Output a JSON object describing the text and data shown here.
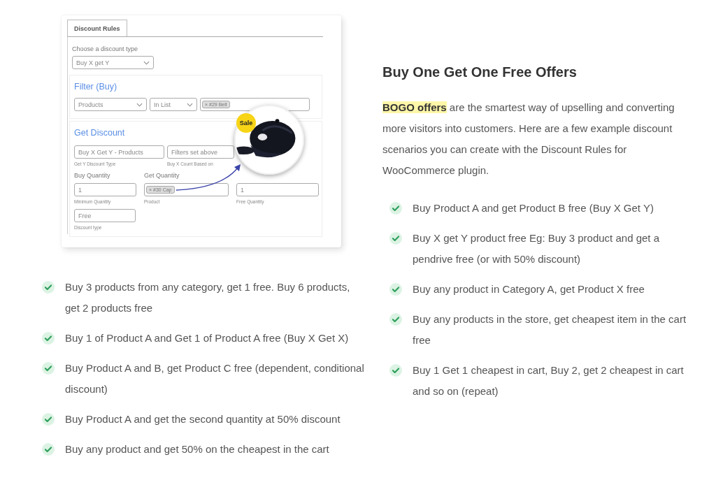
{
  "screenshot": {
    "tab": "Discount Rules",
    "type_label": "Choose a discount type",
    "type_value": "Buy X get Y",
    "filter": {
      "title": "Filter (Buy)",
      "field": "Products",
      "operator": "In List",
      "tag": "× #29 Belt"
    },
    "discount": {
      "title": "Get Discount",
      "type_field": {
        "value": "Buy X Get Y - Products",
        "caption": "Get Y Discount Type"
      },
      "count_field": {
        "value": "Filters set above",
        "caption": "Buy X Count Based on"
      },
      "buy_quantity": {
        "label": "Buy Quantity",
        "value": "1",
        "caption": "Minimum Quantity"
      },
      "get_quantity": {
        "label": "Get Quantity",
        "tag": "× #30 Cap",
        "caption": "Product"
      },
      "free_quantity": {
        "value": "1",
        "caption": "Free Quantity"
      },
      "discount_type": {
        "value": "Free",
        "caption": "Discount type"
      }
    },
    "badge": "Sale"
  },
  "left_list": [
    "Buy 3 products from any category, get 1 free. Buy 6 products, get 2 products free",
    "Buy 1 of Product A and Get 1 of Product A free (Buy X Get X)",
    "Buy Product A and B, get Product C free (dependent, conditional discount)",
    "Buy Product A and get the second quantity at 50% discount",
    "Buy any product and get 50% on the cheapest in the cart"
  ],
  "heading": "Buy One Get One Free Offers",
  "intro": "**BOGO offers** are the smartest way of upselling and converting more visitors into customers. Here are a few example discount scenarios you can create with the Discount Rules for WooCommerce plugin.",
  "right_list": [
    "Buy Product A and get Product B free (Buy X Get Y)",
    "Buy X get Y product free Eg: Buy 3 product and get a pendrive free (or with 50% discount)",
    "Buy any product in Category A, get Product X free",
    "Buy any products in the store, get cheapest item in the cart free",
    "Buy 1 Get 1 cheapest in cart, Buy 2, get 2 cheapest in cart and so on (repeat)"
  ]
}
